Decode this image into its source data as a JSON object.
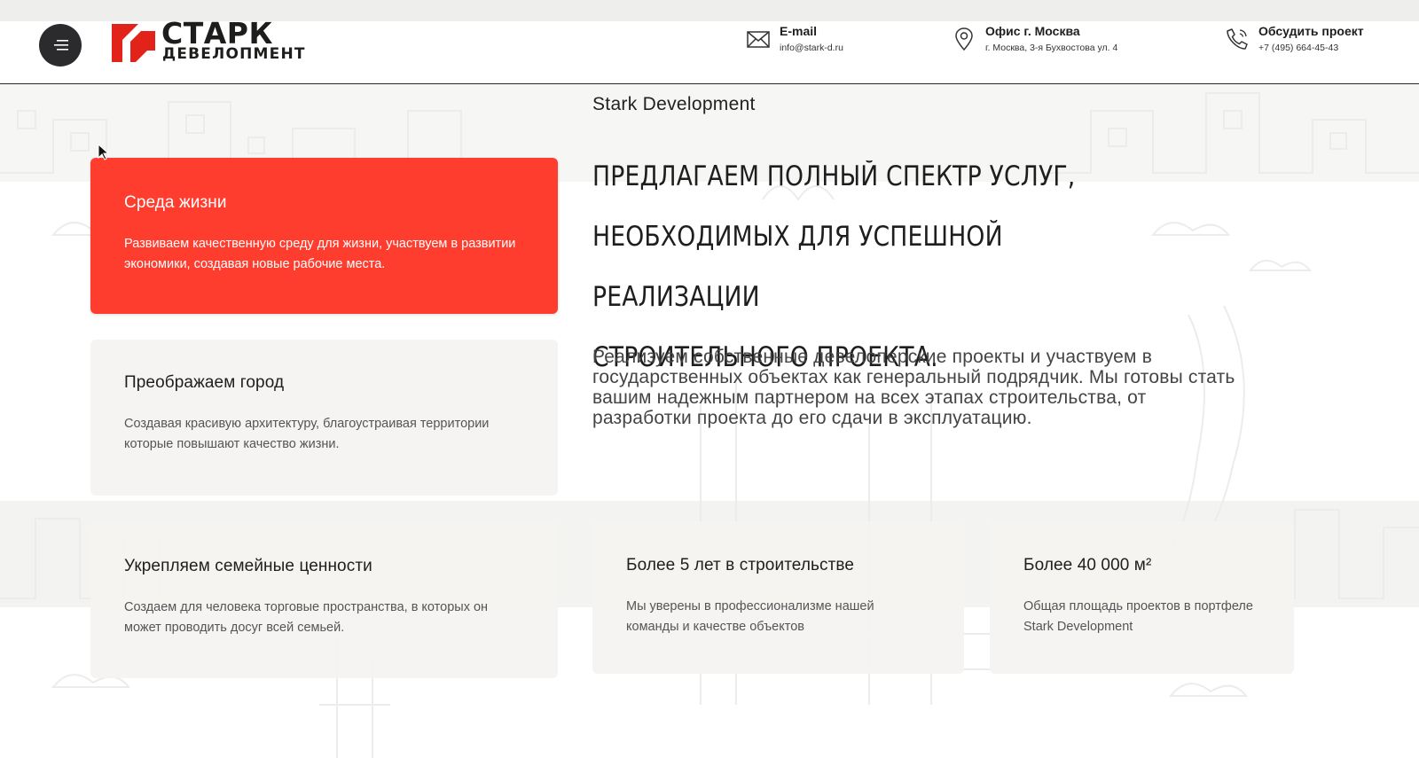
{
  "header": {
    "menu_icon": "menu-icon",
    "logo": {
      "word1": "СТАРК",
      "word2": "ДЕВЕЛОПМЕНТ",
      "colors": {
        "mark": "#e2231a",
        "text": "#1d1d1b"
      }
    },
    "contacts": [
      {
        "icon": "mail-icon",
        "title": "E-mail",
        "subtitle": "info@stark-d.ru"
      },
      {
        "icon": "map-pin-icon",
        "title": "Офис г. Москва",
        "subtitle": "г. Москва, 3-я Бухвостова ул. 4"
      },
      {
        "icon": "phone-icon",
        "title": "Обсудить проект",
        "subtitle": "+7 (495) 664-45-43"
      }
    ]
  },
  "main": {
    "brand_label": "Stark Development",
    "headline": [
      "ПРЕДЛАГАЕМ ПОЛНЫЙ СПЕКТР УСЛУГ,",
      "НЕОБХОДИМЫХ ДЛЯ УСПЕШНОЙ РЕАЛИЗАЦИИ",
      "СТРОИТЕЛЬНОГО ПРОЕКТА."
    ],
    "paragraph": "Реализуем собственные девелоперские проекты и участвуем в государственных объектах как генеральный подрядчик. Мы готовы стать вашим надежным партнером на всех этапах строительства, от разработки проекта до его сдачи в эксплуатацию.",
    "features": [
      {
        "title": "Среда жизни",
        "text": "Развиваем качественную среду для жизни, участвуем в развитии экономики, создавая новые рабочие места.",
        "active": true
      },
      {
        "title": "Преображаем город",
        "text": "Создавая красивую архитектуру, благоустраивая территории которые повышают качество жизни.",
        "active": false
      },
      {
        "title": "Укрепляем семейные ценности",
        "text": "Создаем для человека торговые пространства, в которых он может проводить досуг всей семьей.",
        "active": false
      }
    ],
    "stats": [
      {
        "title": "Более 5 лет в строительстве",
        "text": "Мы уверены в профессионализме нашей команды и качестве объектов"
      },
      {
        "title": "Более 40 000 м²",
        "text": "Общая площадь проектов в портфеле Stark Development"
      }
    ]
  },
  "colors": {
    "accent": "#ff3d2e",
    "card_bg": "#f4f3f1",
    "menu_button": "#2b2b2d"
  }
}
